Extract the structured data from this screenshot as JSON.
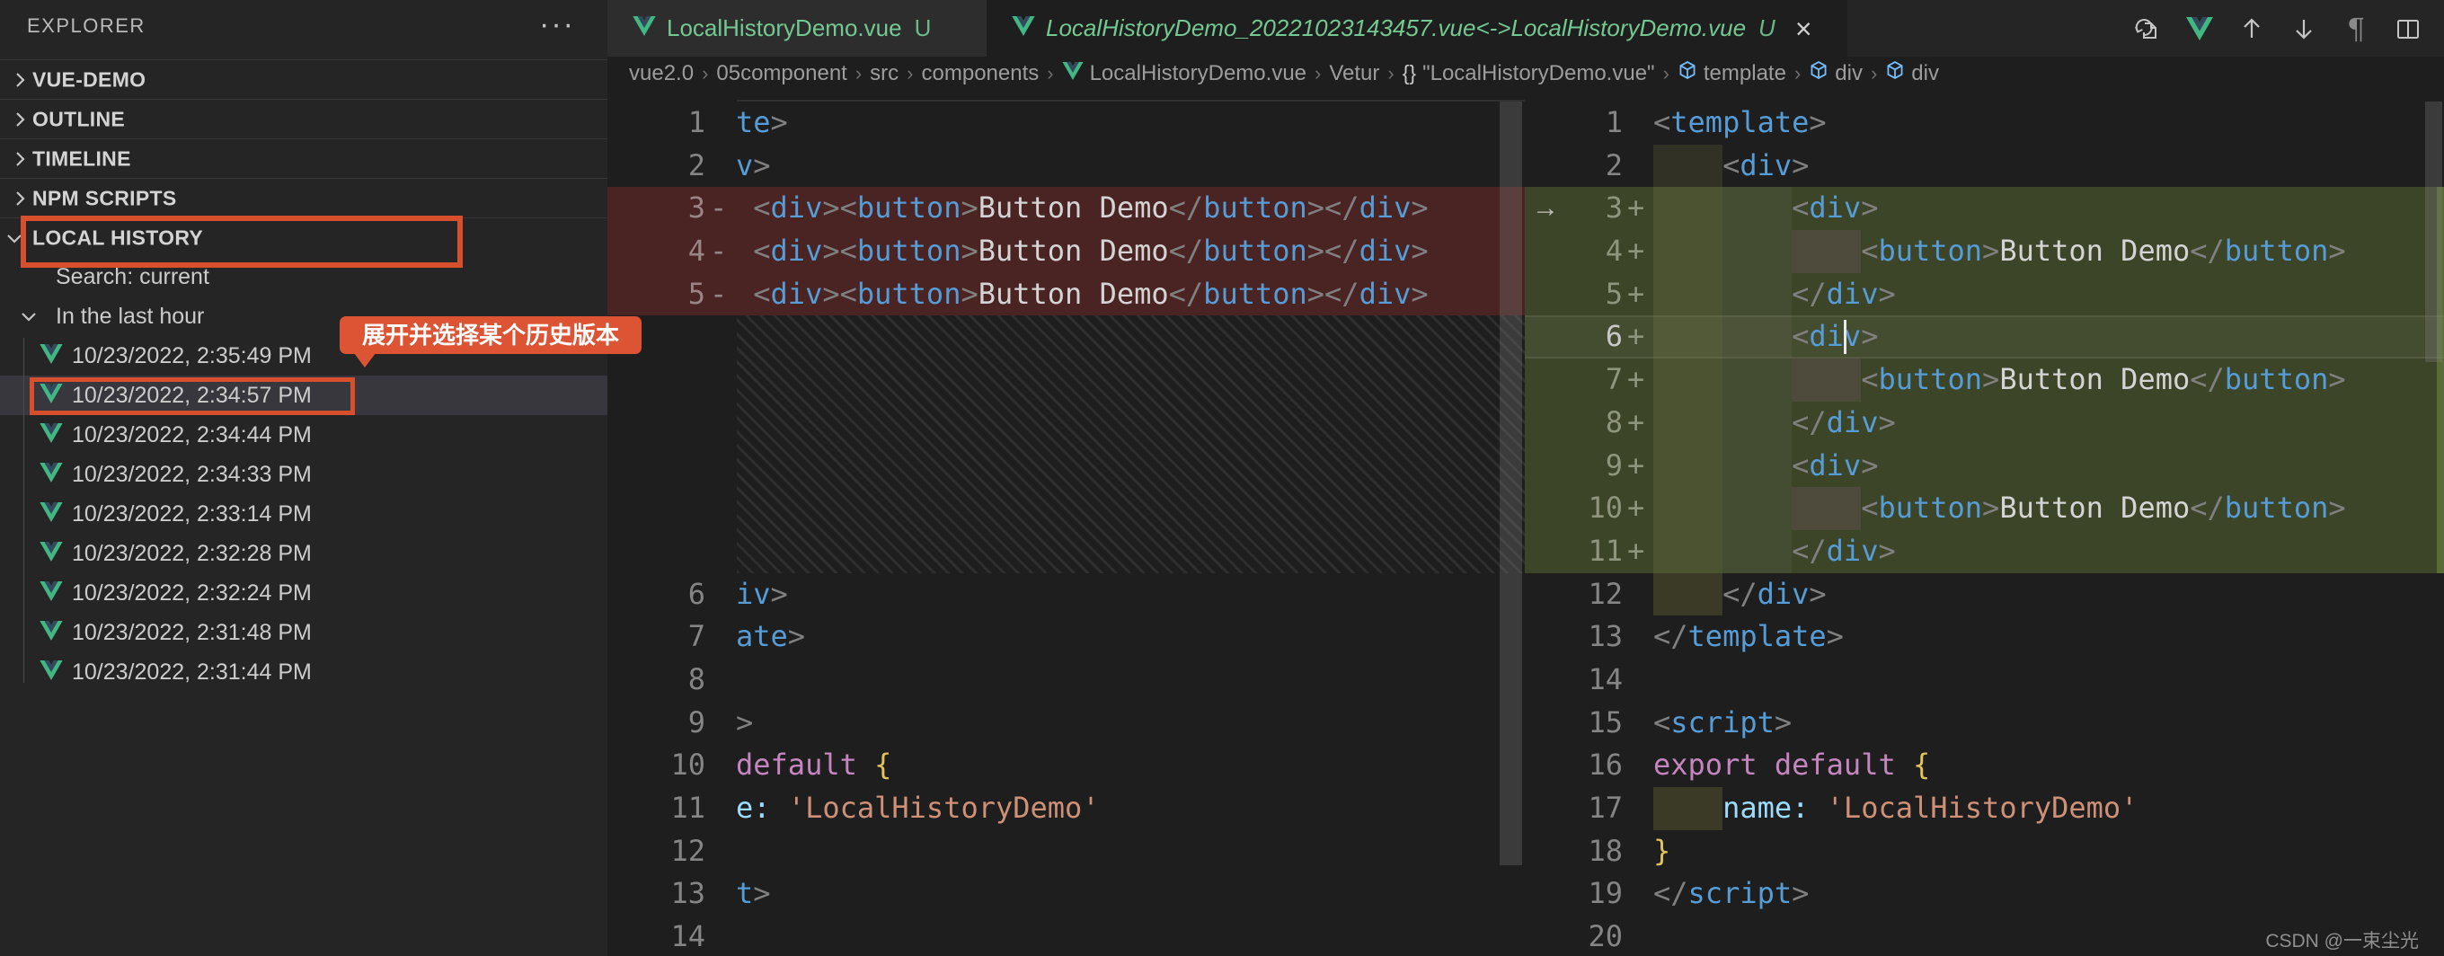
{
  "palette": {
    "annotation_orange": "#d84f2e",
    "untracked_green": "#73c991",
    "added_line_bg": "#3d4529",
    "deleted_line_bg": "#4a2323",
    "symbol_blue": "#75beff",
    "vue_green": "#41b883",
    "vue_dark": "#35495e"
  },
  "sidebar": {
    "title": "EXPLORER",
    "more_icon": "ellipsis-icon",
    "sections": [
      {
        "label": "VUE-DEMO",
        "expanded": false
      },
      {
        "label": "OUTLINE",
        "expanded": false
      },
      {
        "label": "TIMELINE",
        "expanded": false
      },
      {
        "label": "NPM SCRIPTS",
        "expanded": false
      },
      {
        "label": "LOCAL HISTORY",
        "expanded": true,
        "annotated": true
      }
    ],
    "local_history": {
      "search_label": "Search: current",
      "group_label": "In the last hour",
      "entries": [
        {
          "label": "10/23/2022, 2:35:49 PM",
          "selected": false
        },
        {
          "label": "10/23/2022, 2:34:57 PM",
          "selected": true,
          "annotated": true
        },
        {
          "label": "10/23/2022, 2:34:44 PM",
          "selected": false
        },
        {
          "label": "10/23/2022, 2:34:33 PM",
          "selected": false
        },
        {
          "label": "10/23/2022, 2:33:14 PM",
          "selected": false
        },
        {
          "label": "10/23/2022, 2:32:28 PM",
          "selected": false
        },
        {
          "label": "10/23/2022, 2:32:24 PM",
          "selected": false
        },
        {
          "label": "10/23/2022, 2:31:48 PM",
          "selected": false
        },
        {
          "label": "10/23/2022, 2:31:44 PM",
          "selected": false
        }
      ]
    }
  },
  "annotation_tooltip": {
    "text": "展开并选择某个历史版本"
  },
  "tabs": [
    {
      "label": "LocalHistoryDemo.vue",
      "badge": "U",
      "active": false,
      "preview": false,
      "closable": false
    },
    {
      "label": "LocalHistoryDemo_20221023143457.vue<->LocalHistoryDemo.vue",
      "badge": "U",
      "active": true,
      "preview": true,
      "closable": true
    }
  ],
  "editor_toolbar": {
    "icons": [
      "restore-file-icon",
      "vetur-icon",
      "previous-change-icon",
      "next-change-icon",
      "toggle-whitespace-icon",
      "split-editor-icon"
    ]
  },
  "breadcrumb": [
    {
      "label": "vue2.0",
      "icon": null
    },
    {
      "label": "05component",
      "icon": null
    },
    {
      "label": "src",
      "icon": null
    },
    {
      "label": "components",
      "icon": null
    },
    {
      "label": "LocalHistoryDemo.vue",
      "icon": "vue-icon"
    },
    {
      "label": "Vetur",
      "icon": null
    },
    {
      "label": "\"LocalHistoryDemo.vue\"",
      "icon": "braces-icon"
    },
    {
      "label": "template",
      "icon": "symbol-icon"
    },
    {
      "label": "div",
      "icon": "symbol-icon"
    },
    {
      "label": "div",
      "icon": "symbol-icon"
    }
  ],
  "diff": {
    "left_lines": [
      {
        "n": 1,
        "toks": [
          [
            "t",
            "te"
          ],
          [
            "p",
            ">"
          ]
        ]
      },
      {
        "n": 2,
        "toks": [
          [
            "t",
            "v"
          ],
          [
            "p",
            ">"
          ]
        ]
      },
      {
        "n": 3,
        "type": "del",
        "col": 1,
        "toks": [
          [
            "p",
            "<"
          ],
          [
            "t",
            "div"
          ],
          [
            "p",
            "><"
          ],
          [
            "t",
            "button"
          ],
          [
            "p",
            ">"
          ],
          [
            "x",
            "Button Demo"
          ],
          [
            "p",
            "</"
          ],
          [
            "t",
            "button"
          ],
          [
            "p",
            "></"
          ],
          [
            "t",
            "div"
          ],
          [
            "p",
            ">"
          ]
        ]
      },
      {
        "n": 4,
        "type": "del",
        "col": 1,
        "toks": [
          [
            "p",
            "<"
          ],
          [
            "t",
            "div"
          ],
          [
            "p",
            "><"
          ],
          [
            "t",
            "button"
          ],
          [
            "p",
            ">"
          ],
          [
            "x",
            "Button Demo"
          ],
          [
            "p",
            "</"
          ],
          [
            "t",
            "button"
          ],
          [
            "p",
            "></"
          ],
          [
            "t",
            "div"
          ],
          [
            "p",
            ">"
          ]
        ]
      },
      {
        "n": 5,
        "type": "del",
        "col": 1,
        "toks": [
          [
            "p",
            "<"
          ],
          [
            "t",
            "div"
          ],
          [
            "p",
            "><"
          ],
          [
            "t",
            "button"
          ],
          [
            "p",
            ">"
          ],
          [
            "x",
            "Button Demo"
          ],
          [
            "p",
            "</"
          ],
          [
            "t",
            "button"
          ],
          [
            "p",
            "></"
          ],
          [
            "t",
            "div"
          ],
          [
            "p",
            ">"
          ]
        ]
      },
      {
        "type": "filler",
        "rows": 6
      },
      {
        "n": 6,
        "toks": [
          [
            "t",
            "iv"
          ],
          [
            "p",
            ">"
          ]
        ]
      },
      {
        "n": 7,
        "toks": [
          [
            "t",
            "ate"
          ],
          [
            "p",
            ">"
          ]
        ]
      },
      {
        "n": 8,
        "toks": []
      },
      {
        "n": 9,
        "toks": [
          [
            "p",
            ">"
          ]
        ]
      },
      {
        "n": 10,
        "toks": [
          [
            "k",
            "default"
          ],
          [
            "x",
            " "
          ],
          [
            "b",
            "{"
          ]
        ]
      },
      {
        "n": 11,
        "toks": [
          [
            "pr",
            "e:"
          ],
          [
            "x",
            " "
          ],
          [
            "s",
            "'LocalHistoryDemo'"
          ]
        ]
      },
      {
        "n": 12,
        "toks": []
      },
      {
        "n": 13,
        "toks": [
          [
            "t",
            "t"
          ],
          [
            "p",
            ">"
          ]
        ]
      },
      {
        "n": 14,
        "toks": []
      }
    ],
    "right_lines": [
      {
        "n": 1,
        "toks": [
          [
            "p",
            "<"
          ],
          [
            "t",
            "template"
          ],
          [
            "p",
            ">"
          ]
        ]
      },
      {
        "n": 2,
        "col": 4,
        "toks": [
          [
            "p",
            "<"
          ],
          [
            "t",
            "div"
          ],
          [
            "p",
            ">"
          ]
        ]
      },
      {
        "n": 3,
        "type": "add",
        "col": 8,
        "arrow": true,
        "toks": [
          [
            "p",
            "<"
          ],
          [
            "t",
            "div"
          ],
          [
            "p",
            ">"
          ]
        ]
      },
      {
        "n": 4,
        "type": "add",
        "col": 8,
        "block": {
          "w": 4,
          "k": "lt"
        },
        "toks": [
          [
            "p",
            "<"
          ],
          [
            "t",
            "button"
          ],
          [
            "p",
            ">"
          ],
          [
            "x",
            "Button Demo"
          ],
          [
            "p",
            "</"
          ],
          [
            "t",
            "button"
          ],
          [
            "p",
            ">"
          ]
        ]
      },
      {
        "n": 5,
        "type": "add",
        "col": 8,
        "toks": [
          [
            "p",
            "</"
          ],
          [
            "t",
            "div"
          ],
          [
            "p",
            ">"
          ]
        ]
      },
      {
        "n": 6,
        "type": "add",
        "col": 8,
        "current": true,
        "cursor": 11,
        "toks": [
          [
            "p",
            "<"
          ],
          [
            "t",
            "div"
          ],
          [
            "p",
            ">"
          ]
        ]
      },
      {
        "n": 7,
        "type": "add",
        "col": 8,
        "block": {
          "w": 4,
          "k": "lt"
        },
        "toks": [
          [
            "p",
            "<"
          ],
          [
            "t",
            "button"
          ],
          [
            "p",
            ">"
          ],
          [
            "x",
            "Button Demo"
          ],
          [
            "p",
            "</"
          ],
          [
            "t",
            "button"
          ],
          [
            "p",
            ">"
          ]
        ]
      },
      {
        "n": 8,
        "type": "add",
        "col": 8,
        "toks": [
          [
            "p",
            "</"
          ],
          [
            "t",
            "div"
          ],
          [
            "p",
            ">"
          ]
        ]
      },
      {
        "n": 9,
        "type": "add",
        "col": 8,
        "toks": [
          [
            "p",
            "<"
          ],
          [
            "t",
            "div"
          ],
          [
            "p",
            ">"
          ]
        ]
      },
      {
        "n": 10,
        "type": "add",
        "col": 8,
        "block": {
          "w": 4,
          "k": "lt"
        },
        "toks": [
          [
            "p",
            "<"
          ],
          [
            "t",
            "button"
          ],
          [
            "p",
            ">"
          ],
          [
            "x",
            "Button Demo"
          ],
          [
            "p",
            "</"
          ],
          [
            "t",
            "button"
          ],
          [
            "p",
            ">"
          ]
        ]
      },
      {
        "n": 11,
        "type": "add",
        "col": 8,
        "toks": [
          [
            "p",
            "</"
          ],
          [
            "t",
            "div"
          ],
          [
            "p",
            ">"
          ]
        ]
      },
      {
        "n": 12,
        "block": {
          "w": 4,
          "k": "dk"
        },
        "toks": [
          [
            "p",
            "</"
          ],
          [
            "t",
            "div"
          ],
          [
            "p",
            ">"
          ]
        ]
      },
      {
        "n": 13,
        "toks": [
          [
            "p",
            "</"
          ],
          [
            "t",
            "template"
          ],
          [
            "p",
            ">"
          ]
        ]
      },
      {
        "n": 14,
        "toks": []
      },
      {
        "n": 15,
        "toks": [
          [
            "p",
            "<"
          ],
          [
            "t",
            "script"
          ],
          [
            "p",
            ">"
          ]
        ]
      },
      {
        "n": 16,
        "toks": [
          [
            "k",
            "export"
          ],
          [
            "x",
            " "
          ],
          [
            "k",
            "default"
          ],
          [
            "x",
            " "
          ],
          [
            "b",
            "{"
          ]
        ]
      },
      {
        "n": 17,
        "block": {
          "w": 4,
          "k": "dk"
        },
        "toks": [
          [
            "pr",
            "name:"
          ],
          [
            "x",
            " "
          ],
          [
            "s",
            "'LocalHistoryDemo'"
          ]
        ]
      },
      {
        "n": 18,
        "toks": [
          [
            "b",
            "}"
          ]
        ]
      },
      {
        "n": 19,
        "toks": [
          [
            "p",
            "</"
          ],
          [
            "t",
            "script"
          ],
          [
            "p",
            ">"
          ]
        ]
      },
      {
        "n": 20,
        "toks": []
      }
    ]
  },
  "watermark": "CSDN @一束尘光"
}
